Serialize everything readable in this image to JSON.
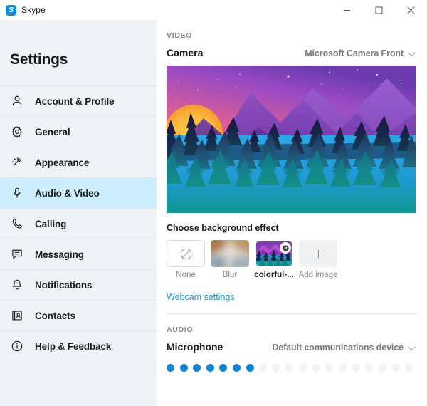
{
  "window": {
    "app_title": "Skype",
    "logo_letter": "S",
    "controls": [
      {
        "name": "minimize",
        "label": "Minimize"
      },
      {
        "name": "maximize",
        "label": "Maximize"
      },
      {
        "name": "close",
        "label": "Close"
      }
    ]
  },
  "sidebar": {
    "title": "Settings",
    "items": [
      {
        "label": "Account & Profile",
        "icon": "person-icon",
        "active": false
      },
      {
        "label": "General",
        "icon": "gear-icon",
        "active": false
      },
      {
        "label": "Appearance",
        "icon": "magic-wand-icon",
        "active": false
      },
      {
        "label": "Audio & Video",
        "icon": "microphone-icon",
        "active": true
      },
      {
        "label": "Calling",
        "icon": "phone-icon",
        "active": false
      },
      {
        "label": "Messaging",
        "icon": "chat-bubble-icon",
        "active": false
      },
      {
        "label": "Notifications",
        "icon": "bell-icon",
        "active": false
      },
      {
        "label": "Contacts",
        "icon": "contact-card-icon",
        "active": false
      },
      {
        "label": "Help & Feedback",
        "icon": "info-circle-icon",
        "active": false
      }
    ]
  },
  "main": {
    "video_section_label": "VIDEO",
    "camera_label": "Camera",
    "camera_device": "Microsoft Camera Front",
    "background_effect_heading": "Choose background effect",
    "background_effects": [
      {
        "caption": "None",
        "type": "none",
        "selected": false
      },
      {
        "caption": "Blur",
        "type": "blur",
        "selected": false
      },
      {
        "caption": "colorful-...",
        "type": "image",
        "selected": true
      },
      {
        "caption": "Add image",
        "type": "add",
        "selected": false
      }
    ],
    "webcam_settings_link": "Webcam settings",
    "audio_section_label": "AUDIO",
    "microphone_label": "Microphone",
    "microphone_device": "Default communications device",
    "mic_level": {
      "total_dots": 19,
      "active_dots": 7
    }
  },
  "colors": {
    "accent_blue": "#1184d6",
    "link_blue": "#2b95d6",
    "active_nav_bg": "#cdeefc",
    "sidebar_bg": "#eff2f6",
    "muted_text": "#8a8a8a"
  }
}
